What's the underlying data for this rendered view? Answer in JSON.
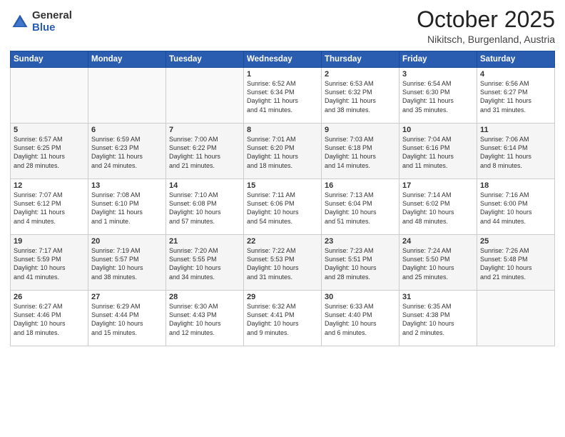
{
  "logo": {
    "general": "General",
    "blue": "Blue"
  },
  "header": {
    "month": "October 2025",
    "location": "Nikitsch, Burgenland, Austria"
  },
  "weekdays": [
    "Sunday",
    "Monday",
    "Tuesday",
    "Wednesday",
    "Thursday",
    "Friday",
    "Saturday"
  ],
  "weeks": [
    [
      {
        "day": "",
        "info": ""
      },
      {
        "day": "",
        "info": ""
      },
      {
        "day": "",
        "info": ""
      },
      {
        "day": "1",
        "info": "Sunrise: 6:52 AM\nSunset: 6:34 PM\nDaylight: 11 hours\nand 41 minutes."
      },
      {
        "day": "2",
        "info": "Sunrise: 6:53 AM\nSunset: 6:32 PM\nDaylight: 11 hours\nand 38 minutes."
      },
      {
        "day": "3",
        "info": "Sunrise: 6:54 AM\nSunset: 6:30 PM\nDaylight: 11 hours\nand 35 minutes."
      },
      {
        "day": "4",
        "info": "Sunrise: 6:56 AM\nSunset: 6:27 PM\nDaylight: 11 hours\nand 31 minutes."
      }
    ],
    [
      {
        "day": "5",
        "info": "Sunrise: 6:57 AM\nSunset: 6:25 PM\nDaylight: 11 hours\nand 28 minutes."
      },
      {
        "day": "6",
        "info": "Sunrise: 6:59 AM\nSunset: 6:23 PM\nDaylight: 11 hours\nand 24 minutes."
      },
      {
        "day": "7",
        "info": "Sunrise: 7:00 AM\nSunset: 6:22 PM\nDaylight: 11 hours\nand 21 minutes."
      },
      {
        "day": "8",
        "info": "Sunrise: 7:01 AM\nSunset: 6:20 PM\nDaylight: 11 hours\nand 18 minutes."
      },
      {
        "day": "9",
        "info": "Sunrise: 7:03 AM\nSunset: 6:18 PM\nDaylight: 11 hours\nand 14 minutes."
      },
      {
        "day": "10",
        "info": "Sunrise: 7:04 AM\nSunset: 6:16 PM\nDaylight: 11 hours\nand 11 minutes."
      },
      {
        "day": "11",
        "info": "Sunrise: 7:06 AM\nSunset: 6:14 PM\nDaylight: 11 hours\nand 8 minutes."
      }
    ],
    [
      {
        "day": "12",
        "info": "Sunrise: 7:07 AM\nSunset: 6:12 PM\nDaylight: 11 hours\nand 4 minutes."
      },
      {
        "day": "13",
        "info": "Sunrise: 7:08 AM\nSunset: 6:10 PM\nDaylight: 11 hours\nand 1 minute."
      },
      {
        "day": "14",
        "info": "Sunrise: 7:10 AM\nSunset: 6:08 PM\nDaylight: 10 hours\nand 57 minutes."
      },
      {
        "day": "15",
        "info": "Sunrise: 7:11 AM\nSunset: 6:06 PM\nDaylight: 10 hours\nand 54 minutes."
      },
      {
        "day": "16",
        "info": "Sunrise: 7:13 AM\nSunset: 6:04 PM\nDaylight: 10 hours\nand 51 minutes."
      },
      {
        "day": "17",
        "info": "Sunrise: 7:14 AM\nSunset: 6:02 PM\nDaylight: 10 hours\nand 48 minutes."
      },
      {
        "day": "18",
        "info": "Sunrise: 7:16 AM\nSunset: 6:00 PM\nDaylight: 10 hours\nand 44 minutes."
      }
    ],
    [
      {
        "day": "19",
        "info": "Sunrise: 7:17 AM\nSunset: 5:59 PM\nDaylight: 10 hours\nand 41 minutes."
      },
      {
        "day": "20",
        "info": "Sunrise: 7:19 AM\nSunset: 5:57 PM\nDaylight: 10 hours\nand 38 minutes."
      },
      {
        "day": "21",
        "info": "Sunrise: 7:20 AM\nSunset: 5:55 PM\nDaylight: 10 hours\nand 34 minutes."
      },
      {
        "day": "22",
        "info": "Sunrise: 7:22 AM\nSunset: 5:53 PM\nDaylight: 10 hours\nand 31 minutes."
      },
      {
        "day": "23",
        "info": "Sunrise: 7:23 AM\nSunset: 5:51 PM\nDaylight: 10 hours\nand 28 minutes."
      },
      {
        "day": "24",
        "info": "Sunrise: 7:24 AM\nSunset: 5:50 PM\nDaylight: 10 hours\nand 25 minutes."
      },
      {
        "day": "25",
        "info": "Sunrise: 7:26 AM\nSunset: 5:48 PM\nDaylight: 10 hours\nand 21 minutes."
      }
    ],
    [
      {
        "day": "26",
        "info": "Sunrise: 6:27 AM\nSunset: 4:46 PM\nDaylight: 10 hours\nand 18 minutes."
      },
      {
        "day": "27",
        "info": "Sunrise: 6:29 AM\nSunset: 4:44 PM\nDaylight: 10 hours\nand 15 minutes."
      },
      {
        "day": "28",
        "info": "Sunrise: 6:30 AM\nSunset: 4:43 PM\nDaylight: 10 hours\nand 12 minutes."
      },
      {
        "day": "29",
        "info": "Sunrise: 6:32 AM\nSunset: 4:41 PM\nDaylight: 10 hours\nand 9 minutes."
      },
      {
        "day": "30",
        "info": "Sunrise: 6:33 AM\nSunset: 4:40 PM\nDaylight: 10 hours\nand 6 minutes."
      },
      {
        "day": "31",
        "info": "Sunrise: 6:35 AM\nSunset: 4:38 PM\nDaylight: 10 hours\nand 2 minutes."
      },
      {
        "day": "",
        "info": ""
      }
    ]
  ]
}
